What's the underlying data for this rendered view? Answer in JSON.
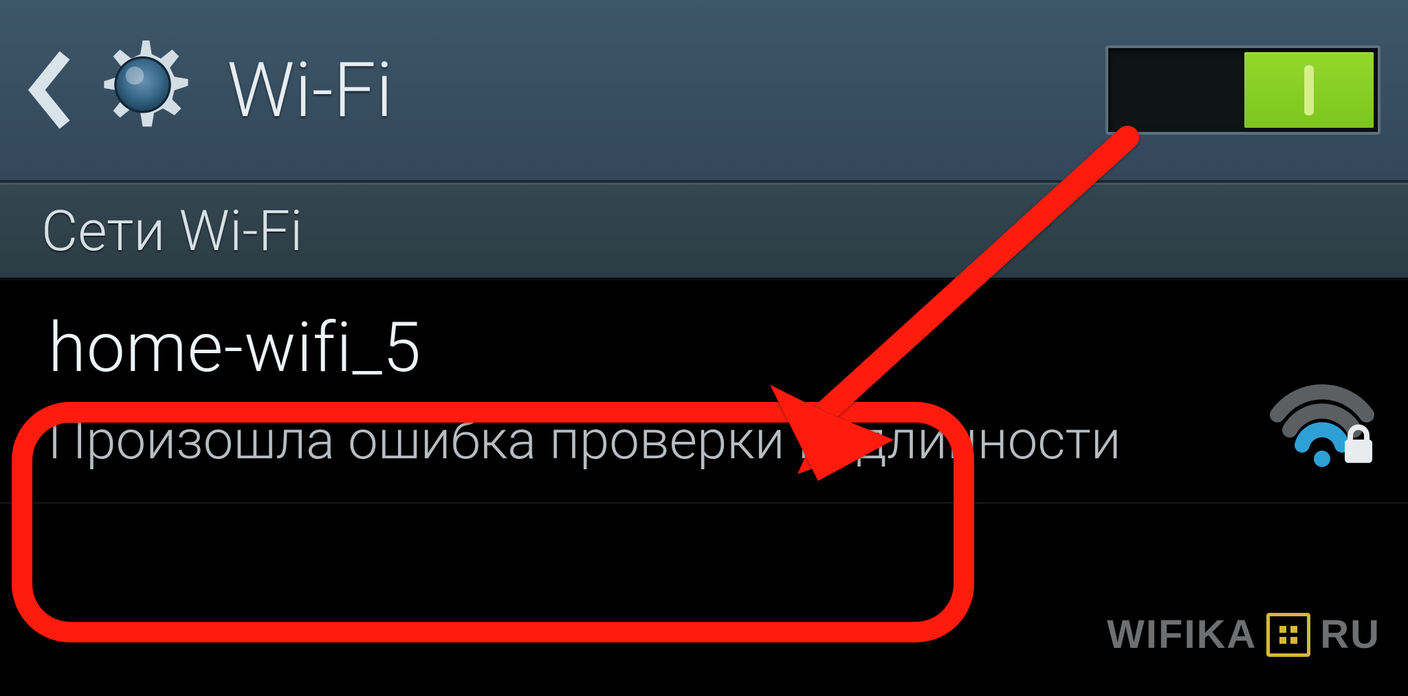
{
  "header": {
    "title": "Wi-Fi",
    "toggle_on": true
  },
  "section": {
    "heading": "Сети Wi-Fi"
  },
  "networks": [
    {
      "ssid": "home-wifi_5",
      "status": "Произошла ошибка проверки подлинности",
      "secured": true
    }
  ],
  "watermark": {
    "left": "WIFIKA",
    "right": "RU"
  }
}
